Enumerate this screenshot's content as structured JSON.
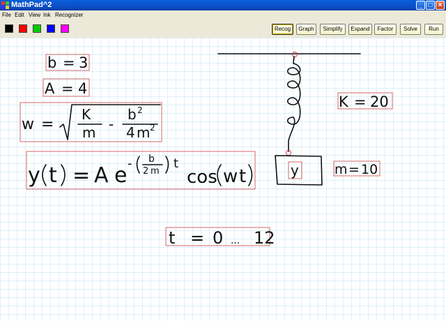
{
  "window": {
    "title": "MathPad^2"
  },
  "menu": [
    "File",
    "Edit",
    "View",
    "Ink",
    "Recognizer"
  ],
  "ink_colors": [
    "#000000",
    "#ff0000",
    "#00cc00",
    "#0000ff",
    "#ff00ff"
  ],
  "toolbar": {
    "buttons": [
      "Recog",
      "Graph",
      "Simplify",
      "Expand",
      "Factor",
      "Solve",
      "Run"
    ],
    "active": "Recog"
  },
  "equations": {
    "b": {
      "lhs": "b",
      "eq": "=",
      "rhs": "3"
    },
    "A": {
      "lhs": "A",
      "eq": "=",
      "rhs": "4"
    },
    "w": {
      "lhs": "w",
      "eq": "=",
      "k": "K",
      "m": "m",
      "minus": "-",
      "b2": "b",
      "sq": "2",
      "four": "4",
      "m2": "m",
      "sq2": "2"
    },
    "y": {
      "y": "y",
      "t": "t",
      "eq": "=",
      "A": "A",
      "e": "e",
      "neg": "-",
      "b": "b",
      "two": "2",
      "m": "m",
      "texp": "t",
      "cos": "cos",
      "w": "w",
      "t2": "t"
    },
    "t": {
      "lhs": "t",
      "eq": "=",
      "start": "0",
      "dots": "...",
      "end": "12"
    },
    "K": {
      "lhs": "K",
      "eq": "=",
      "rhs": "20"
    },
    "m": {
      "lhs": "m",
      "eq": "=",
      "rhs": "10"
    },
    "mass_label": "y"
  }
}
